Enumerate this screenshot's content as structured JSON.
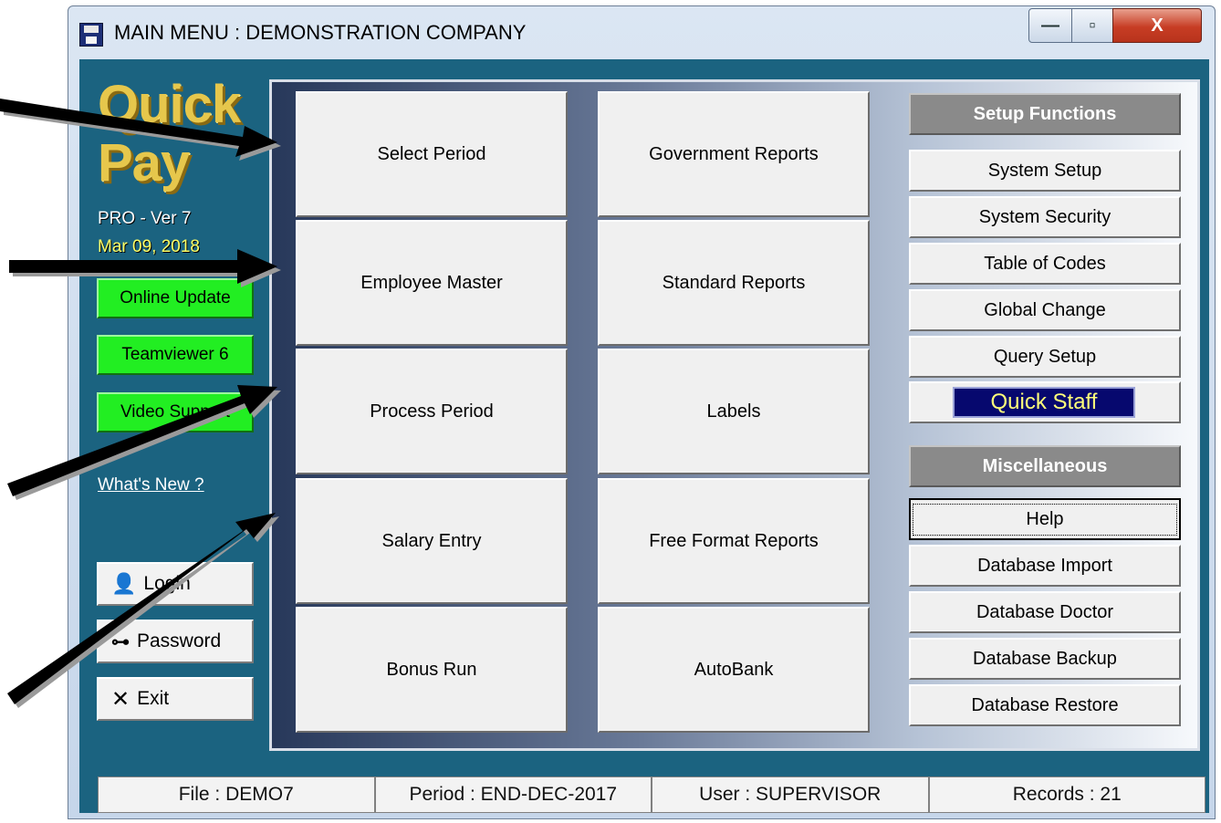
{
  "window": {
    "title": "MAIN MENU : DEMONSTRATION COMPANY"
  },
  "controls": {
    "minimize_icon": "minimize-icon",
    "maximize_icon": "maximize-icon",
    "close_icon": "close-icon"
  },
  "sidebar": {
    "logo_line1": "Quick",
    "logo_line2": "Pay",
    "version": "PRO - Ver 7",
    "date": "Mar 09, 2018",
    "green_buttons": [
      "Online Update",
      "Teamviewer 6",
      "Video Support"
    ],
    "whats_new": "What's New ?",
    "login": "Login",
    "password": "Password",
    "exit": "Exit"
  },
  "main_buttons": {
    "col1": [
      "Select Period",
      "Employee Master",
      "Process Period",
      "Salary Entry",
      "Bonus Run"
    ],
    "col2": [
      "Government Reports",
      "Standard Reports",
      "Labels",
      "Free Format Reports",
      "AutoBank"
    ]
  },
  "setup": {
    "header": "Setup Functions",
    "items": [
      "System Setup",
      "System Security",
      "Table of Codes",
      "Global Change",
      "Query Setup"
    ],
    "quick_staff": "Quick Staff"
  },
  "misc": {
    "header": "Miscellaneous",
    "items": [
      "Help",
      "Database Import",
      "Database Doctor",
      "Database Backup",
      "Database Restore"
    ]
  },
  "status": {
    "file": "File : DEMO7",
    "period": "Period : END-DEC-2017",
    "user": "User : SUPERVISOR",
    "records": "Records : 21"
  },
  "colors": {
    "client_bg": "#1b6380",
    "green_button": "#22ee22",
    "quick_staff_bg": "#06086e"
  }
}
